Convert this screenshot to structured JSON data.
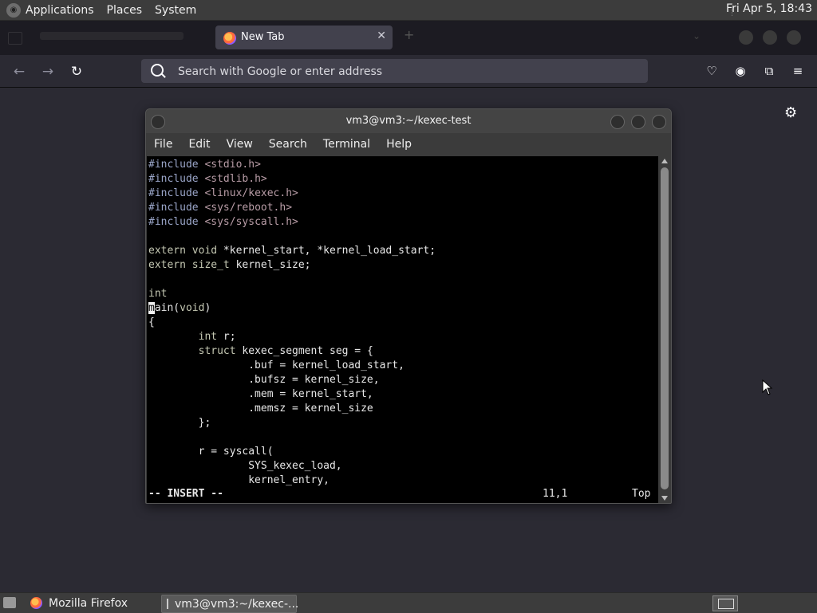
{
  "top_panel": {
    "menus": [
      "Applications",
      "Places",
      "System"
    ],
    "clock": "Fri Apr  5, 18:43"
  },
  "browser": {
    "active_tab_title": "New Tab",
    "url_placeholder": "Search with Google or enter address"
  },
  "terminal": {
    "title": "vm3@vm3:~/kexec-test",
    "menu": [
      "File",
      "Edit",
      "View",
      "Search",
      "Terminal",
      "Help"
    ],
    "mode": "-- INSERT --",
    "position": "11,1",
    "scroll_position": "Top"
  },
  "taskbar": {
    "items": [
      "Mozilla Firefox",
      "vm3@vm3:~/kexec-..."
    ]
  },
  "icons": [
    "back-arrow-icon",
    "forward-arrow-icon",
    "reload-icon",
    "search-icon",
    "pocket-icon",
    "account-icon",
    "extensions-icon",
    "menu-icon",
    "gear-icon",
    "firefox-icon",
    "terminal-icon"
  ]
}
